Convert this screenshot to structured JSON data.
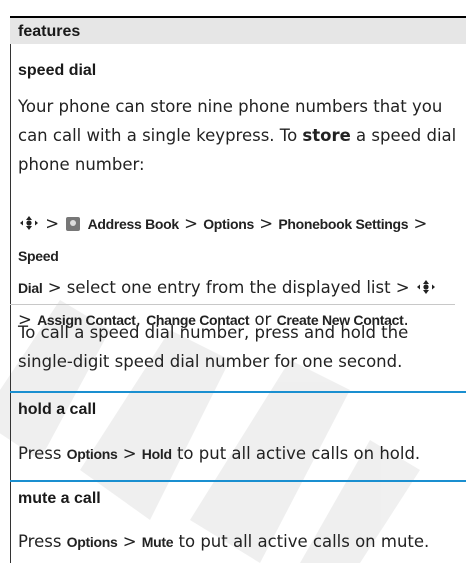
{
  "section_header": "features",
  "speed_dial": {
    "title": "speed dial",
    "intro_1": "Your phone can store nine phone numbers that you can call with a single keypress. To ",
    "intro_store": "store",
    "intro_2": " a speed dial phone number:",
    "path_address_book": "Address Book",
    "path_options": "Options",
    "path_phonebook_settings": "Phonebook Settings",
    "path_speed": "Speed",
    "path_dial": "Dial",
    "path_select": " > select one entry from the displayed list > ",
    "assign_contact": "Assign Contact",
    "change_contact": "Change Contact",
    "or": " or ",
    "create_new_contact": "Create New Contact",
    "call_text": "To call a speed dial number, press and hold the single-digit speed dial number for one second."
  },
  "hold_call": {
    "title": "hold a call",
    "press": "Press ",
    "options": "Options",
    "hold": "Hold",
    "rest": " to put all active calls on hold."
  },
  "mute_call": {
    "title": "mute a call",
    "press": "Press ",
    "options": "Options",
    "mute": "Mute",
    "rest": " to put all active calls on mute."
  },
  "icons": [
    "nav-key-icon",
    "address-book-icon"
  ]
}
